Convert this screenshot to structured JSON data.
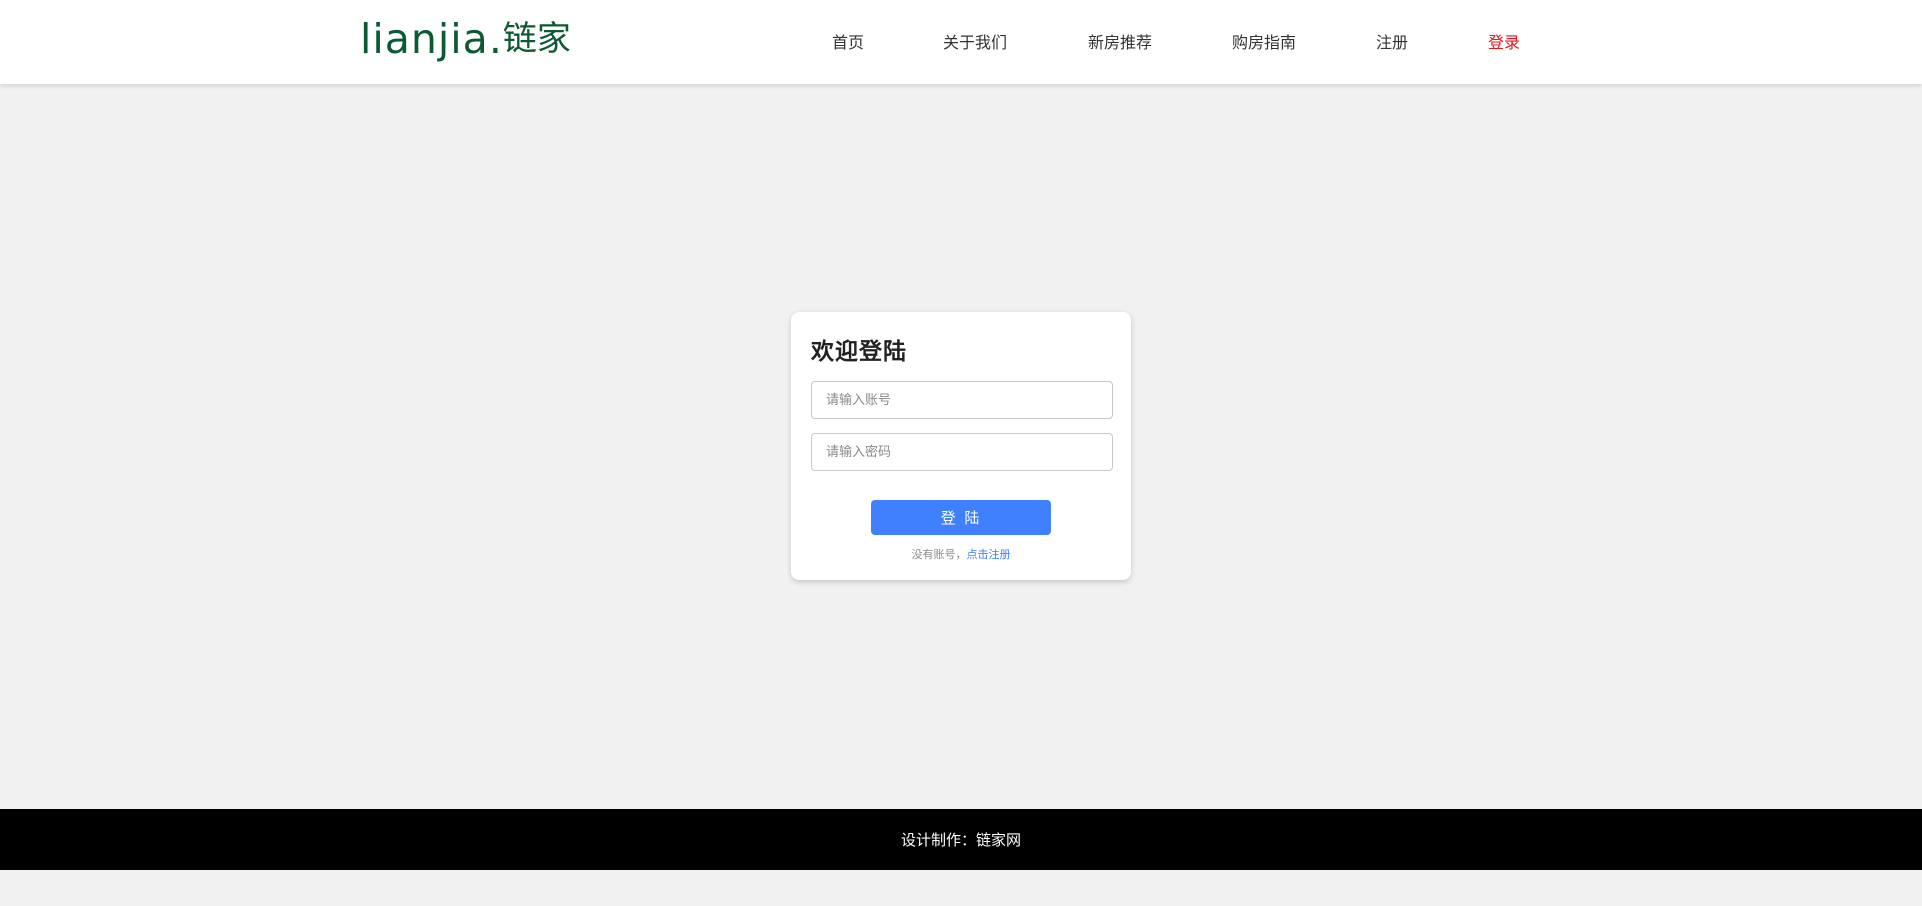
{
  "header": {
    "logo_latin": "lianjia",
    "logo_dot": ".",
    "logo_cn": "链家",
    "nav": [
      {
        "label": "首页"
      },
      {
        "label": "关于我们"
      },
      {
        "label": "新房推荐"
      },
      {
        "label": "购房指南"
      },
      {
        "label": "注册"
      },
      {
        "label": "登录",
        "active": true
      }
    ]
  },
  "login": {
    "title": "欢迎登陆",
    "username_placeholder": "请输入账号",
    "username_value": "",
    "password_placeholder": "请输入密码",
    "password_value": "",
    "submit_label": "登 陆",
    "no_account_text": "没有账号，",
    "register_link": "点击注册"
  },
  "footer": {
    "text": "设计制作：链家网"
  },
  "colors": {
    "brand_green": "#0b5a33",
    "active_nav_red": "#e4171d",
    "primary_blue": "#3f80fe",
    "page_bg": "#f1f1f1",
    "footer_bg": "#000000"
  }
}
